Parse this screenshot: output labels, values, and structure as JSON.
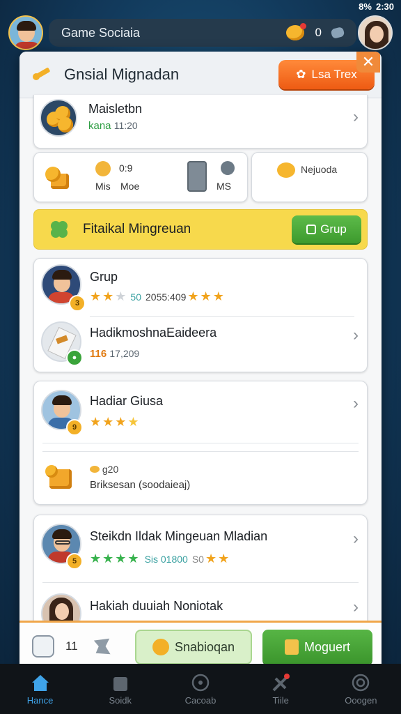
{
  "statusbar": {
    "battery": "8%",
    "time": "2:30"
  },
  "topbar": {
    "title": "Game Sociaia",
    "count": "0"
  },
  "panel": {
    "title": "Gnsial Mignadan",
    "header_button": "Lsa Trex",
    "close": "✕"
  },
  "profile": {
    "name": "Maisletbn",
    "subtitle_prefix": "kana",
    "subtitle_value": "11:20"
  },
  "stats": [
    {
      "value": "0:9",
      "label_left": "Mis",
      "label_right": "Moe",
      "extra": "MS"
    },
    {
      "label": "Nejuoda"
    }
  ],
  "featured": {
    "title": "Fitaikal Mingreuan",
    "button": "Grup"
  },
  "list": [
    {
      "name": "Grup",
      "stars_on": 2,
      "stars_off": 1,
      "score": "50",
      "time": "2055:409",
      "extra_stars": 3
    },
    {
      "name": "HadikmoshnaEaideera",
      "score": "116",
      "time": "17,209"
    },
    {
      "name": "Hadiar Giusa",
      "stars_on": 3,
      "stars_extra": 1
    },
    {
      "name": "g20",
      "subtitle": "Briksesan (soodaieaj)"
    },
    {
      "name": "Steikdn Ildak Mingeuan Mladian",
      "stars": 4,
      "score": "Sis 01800",
      "score2": "S0",
      "extra_stars": 2
    },
    {
      "name": "Hakiah duuiah Noniotak"
    }
  ],
  "bottom": {
    "count": "11",
    "btn_light": "Snabioqan",
    "btn_dark": "Moguert"
  },
  "nav": [
    {
      "label": "Hance",
      "icon": "home-icon"
    },
    {
      "label": "Soidk",
      "icon": "bag-icon"
    },
    {
      "label": "Cacoab",
      "icon": "circle-icon"
    },
    {
      "label": "Tiile",
      "icon": "sword-icon"
    },
    {
      "label": "Ooogen",
      "icon": "camera-icon"
    }
  ],
  "colors": {
    "accent_orange": "#ee5b13",
    "accent_green": "#3d9a2d",
    "active_nav": "#3fa3e8",
    "featured_bar": "#f7d94c"
  }
}
